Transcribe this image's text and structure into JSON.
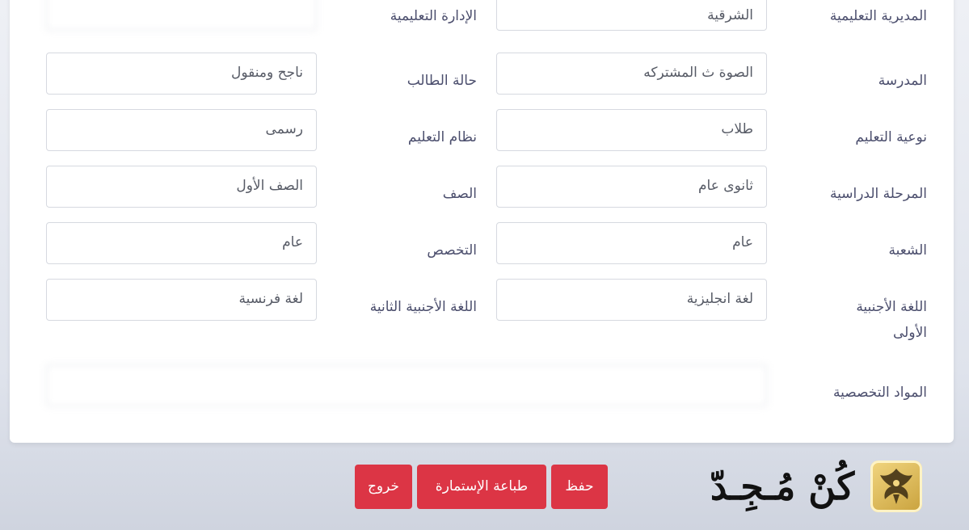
{
  "form": {
    "rows": [
      {
        "right_label": "المديرية التعليمية",
        "right_value": "الشرقية",
        "left_label": "الإدارة التعليمية",
        "left_value": ""
      },
      {
        "right_label": "المدرسة",
        "right_value": "الصوة ث المشتركه",
        "left_label": "حالة الطالب",
        "left_value": "ناجح ومنقول"
      },
      {
        "right_label": "نوعية التعليم",
        "right_value": "طلاب",
        "left_label": "نظام التعليم",
        "left_value": "رسمى"
      },
      {
        "right_label": "المرحلة الدراسية",
        "right_value": "ثانوى عام",
        "left_label": "الصف",
        "left_value": "الصف الأول"
      },
      {
        "right_label": "الشعبة",
        "right_value": "عام",
        "left_label": "التخصص",
        "left_value": "عام"
      },
      {
        "right_label": "اللغة الأجنبية الأولى",
        "right_value": "لغة انجليزية",
        "left_label": "اللغة الأجنبية الثانية",
        "left_value": "لغة فرنسية"
      }
    ],
    "specialized": {
      "label": "المواد التخصصية",
      "value": ""
    }
  },
  "actions": {
    "save": "حفظ",
    "print": "طباعة الإستمارة",
    "exit": "خروج"
  },
  "brand": {
    "logo_text": "كُنْ مُـجِـدّ",
    "badge_icon": "phoenix-icon"
  },
  "colors": {
    "danger": "#dc3545",
    "label": "#4b4e6d",
    "border": "#d6d9e0"
  }
}
